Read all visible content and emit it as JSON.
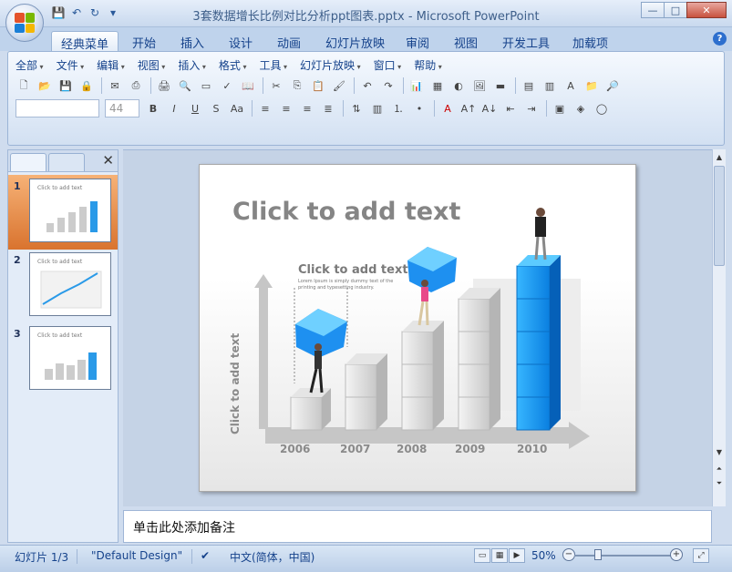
{
  "window": {
    "title": "3套数据增长比例对比分析ppt图表.pptx - Microsoft PowerPoint",
    "buttons": {
      "minimize": "—",
      "restore": "□",
      "close": "✕"
    }
  },
  "ribbon_tabs": [
    {
      "label": "经典菜单"
    },
    {
      "label": "开始"
    },
    {
      "label": "插入"
    },
    {
      "label": "设计"
    },
    {
      "label": "动画"
    },
    {
      "label": "幻灯片放映"
    },
    {
      "label": "审阅"
    },
    {
      "label": "视图"
    },
    {
      "label": "开发工具"
    },
    {
      "label": "加载项"
    }
  ],
  "classic_menu": [
    {
      "label": "全部"
    },
    {
      "label": "文件"
    },
    {
      "label": "编辑"
    },
    {
      "label": "视图"
    },
    {
      "label": "插入"
    },
    {
      "label": "格式"
    },
    {
      "label": "工具"
    },
    {
      "label": "幻灯片放映"
    },
    {
      "label": "窗口"
    },
    {
      "label": "帮助"
    }
  ],
  "font_box": {
    "font_name": "",
    "font_size": "44"
  },
  "thumbnails": [
    {
      "num": "1",
      "title": "Click to add text"
    },
    {
      "num": "2",
      "title": "Click to add text"
    },
    {
      "num": "3",
      "title": "Click to add text"
    }
  ],
  "slide": {
    "title": "Click to add text",
    "subtitle": "Click to add text",
    "body": "Lorem Ipsum is simply dummy text of the printing and typesetting industry.",
    "y_label": "Click to add text",
    "years": [
      "2006",
      "2007",
      "2008",
      "2009",
      "2010"
    ],
    "stack_counts": [
      1,
      2,
      3,
      4,
      5
    ]
  },
  "notes_placeholder": "单击此处添加备注",
  "status": {
    "slide": "幻灯片 1/3",
    "theme": "\"Default Design\"",
    "language": "中文(简体，中国)",
    "zoom": "50%"
  }
}
